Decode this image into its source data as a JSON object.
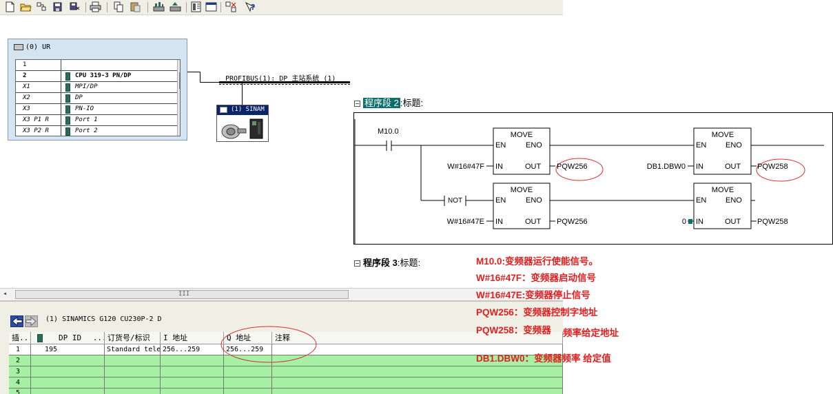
{
  "toolbar": {
    "icons": [
      "new-icon",
      "open-icon",
      "open-online-icon",
      "save-icon",
      "save-compile-icon",
      "print-icon",
      "copy-icon",
      "paste-icon",
      "download-icon",
      "upload-icon",
      "catalog-icon",
      "network-icon",
      "properties-icon",
      "help-icon"
    ]
  },
  "rack": {
    "title": "(0) UR",
    "rows": [
      {
        "slot": "1",
        "module": ""
      },
      {
        "slot": "2",
        "module": "CPU 319-3 PN/DP"
      },
      {
        "slot": "X1",
        "module": "MPI/DP"
      },
      {
        "slot": "X2",
        "module": "DP"
      },
      {
        "slot": "X3",
        "module": "PN-IO"
      },
      {
        "slot": "X3 P1 R",
        "module": "Port 1"
      },
      {
        "slot": "X3 P2 R",
        "module": "Port 2"
      }
    ]
  },
  "bus": {
    "label": "PROFIBUS(1): DP 主站系统 (1)"
  },
  "device": {
    "label": "(1) SINAM"
  },
  "hscroll": {
    "grip": "III"
  },
  "detail": {
    "title": "(1)   SINAMICS G120 CU230P-2 D",
    "columns": [
      "插...",
      "DP ID",
      "...",
      "订货号/标识",
      "I 地址",
      "Q 地址",
      "注释"
    ],
    "rows": [
      {
        "slot": "1",
        "dpid": "195",
        "order": "Standard tele",
        "i_addr": "256...259",
        "q_addr": "256...259",
        "comment": ""
      },
      {
        "slot": "2",
        "dpid": "",
        "order": "",
        "i_addr": "",
        "q_addr": "",
        "comment": ""
      },
      {
        "slot": "3",
        "dpid": "",
        "order": "",
        "i_addr": "",
        "q_addr": "",
        "comment": ""
      },
      {
        "slot": "4",
        "dpid": "",
        "order": "",
        "i_addr": "",
        "q_addr": "",
        "comment": ""
      },
      {
        "slot": "5",
        "dpid": "",
        "order": "",
        "i_addr": "",
        "q_addr": "",
        "comment": ""
      }
    ]
  },
  "ladder": {
    "network2": {
      "label": "程序段",
      "num": "2",
      "title": ":标题:"
    },
    "network3": {
      "label": "程序段",
      "num": "3",
      "title": ":标题:"
    },
    "contact1": "M10.0",
    "contact2": "NOT",
    "move": "MOVE",
    "en": "EN",
    "eno": "ENO",
    "in": "IN",
    "out": "OUT",
    "move1_in": "W#16#47F",
    "move1_out": "PQW256",
    "move2_in": "DB1.DBW0",
    "move2_out": "PQW258",
    "move3_in": "W#16#47E",
    "move3_out": "PQW256",
    "move4_in": "0",
    "move4_out": "PQW258"
  },
  "notes": [
    "M10.0:变频器运行使能信号。",
    "W#16#47F：变频器启动信号",
    "W#16#47E:变频器停止信号",
    "PQW256：变频器控制字地址",
    "PQW258：变频器",
    "频率给定地址",
    "DB1.DBW0：变频器频率 给定值"
  ]
}
